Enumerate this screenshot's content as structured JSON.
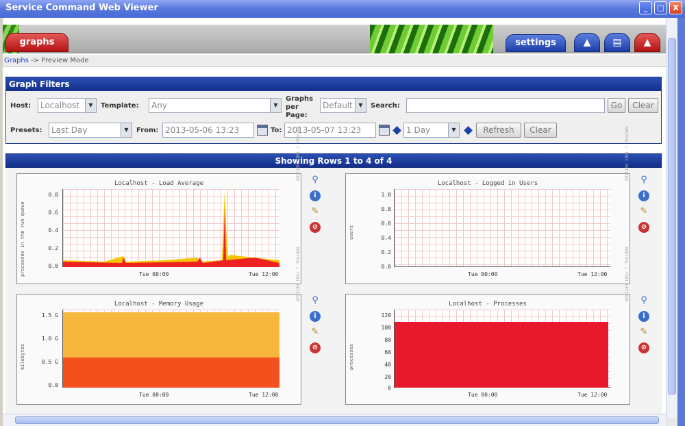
{
  "window": {
    "title": "Service Command Web Viewer",
    "min": "_",
    "max": "□",
    "close": "X"
  },
  "header": {
    "tab_graphs": "graphs",
    "tab_settings": "settings",
    "icon1": "tree-icon",
    "icon2": "list-icon",
    "icon3": "car-icon"
  },
  "breadcrumb": {
    "link": "Graphs",
    "sep": "->",
    "current": "Preview Mode"
  },
  "filters": {
    "title": "Graph Filters",
    "host_label": "Host:",
    "host_value": "Localhost",
    "template_label": "Template:",
    "template_value": "Any",
    "gpp_label": "Graphs per Page:",
    "gpp_value": "Default",
    "search_label": "Search:",
    "search_value": "",
    "go": "Go",
    "clear": "Clear",
    "presets_label": "Presets:",
    "presets_value": "Last Day",
    "from_label": "From:",
    "from_value": "2013-05-06 13:23",
    "to_label": "To:",
    "to_value": "2013-05-07 13:23",
    "span_value": "1 Day",
    "refresh": "Refresh",
    "clear2": "Clear"
  },
  "results": {
    "title": "Showing Rows 1 to 4 of 4"
  },
  "graphs": [
    {
      "title": "Localhost - Load Average",
      "ylabel": "processes in the run queue",
      "yticks": [
        "0.8",
        "0.6",
        "0.4",
        "0.2",
        "0.0"
      ],
      "xticks": [
        "Tue 00:00",
        "Tue 12:00"
      ]
    },
    {
      "title": "Localhost - Logged in Users",
      "ylabel": "users",
      "yticks": [
        "1.0",
        "0.8",
        "0.6",
        "0.4",
        "0.2",
        "0.0"
      ],
      "xticks": [
        "Tue 00:00",
        "Tue 12:00"
      ]
    },
    {
      "title": "Localhost - Memory Usage",
      "ylabel": "kilobytes",
      "yticks": [
        "1.5 G",
        "1.0 G",
        "0.5 G",
        "0.0"
      ],
      "xticks": [
        "Tue 00:00",
        "Tue 12:00"
      ]
    },
    {
      "title": "Localhost - Processes",
      "ylabel": "processes",
      "yticks": [
        "120",
        "100",
        "80",
        "60",
        "40",
        "20",
        "0"
      ],
      "xticks": [
        "Tue 00:00",
        "Tue 12:00"
      ]
    }
  ],
  "side_label": "RRDTOOL / TOBI OETIKER",
  "graph_icons": [
    "zoom-icon",
    "info-icon",
    "edit-icon",
    "delete-icon"
  ]
}
